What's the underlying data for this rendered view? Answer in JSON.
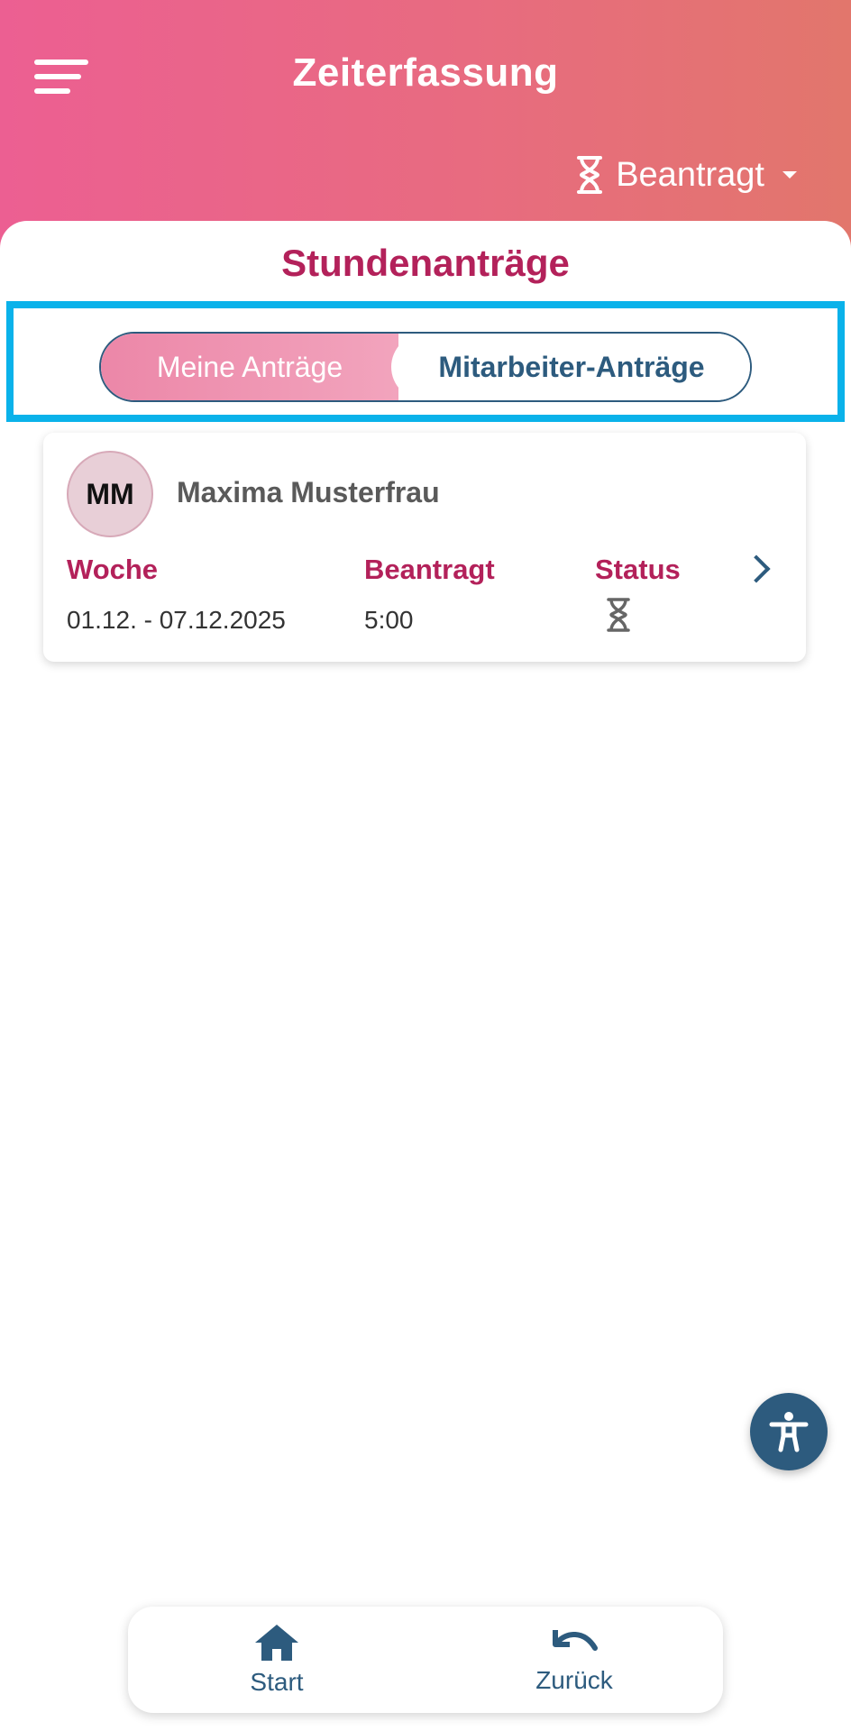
{
  "header": {
    "title": "Zeiterfassung",
    "menu_icon": "hamburger-menu-icon",
    "filter": {
      "icon": "hourglass-icon",
      "label": "Beantragt"
    }
  },
  "section": {
    "title": "Stundenanträge"
  },
  "toggle": {
    "left_label": "Meine Anträge",
    "right_label": "Mitarbeiter-Anträge",
    "selected": "Mitarbeiter-Anträge"
  },
  "requests": [
    {
      "initials": "MM",
      "name": "Maxima Musterfrau",
      "week_label": "Woche",
      "week_value": "01.12. - 07.12.2025",
      "requested_label": "Beantragt",
      "requested_value": "5:00",
      "status_label": "Status",
      "status_icon": "hourglass-icon"
    }
  ],
  "fab": {
    "icon": "accessibility-icon"
  },
  "bottom_nav": {
    "items": [
      {
        "label": "Start",
        "icon": "home-icon"
      },
      {
        "label": "Zurück",
        "icon": "undo-icon"
      }
    ]
  },
  "colors": {
    "header_gradient_start": "#ec5f92",
    "header_gradient_end": "#e2766c",
    "accent_magenta": "#b3215a",
    "navy": "#2d5b7e",
    "highlight_frame": "#0ab2ea"
  }
}
